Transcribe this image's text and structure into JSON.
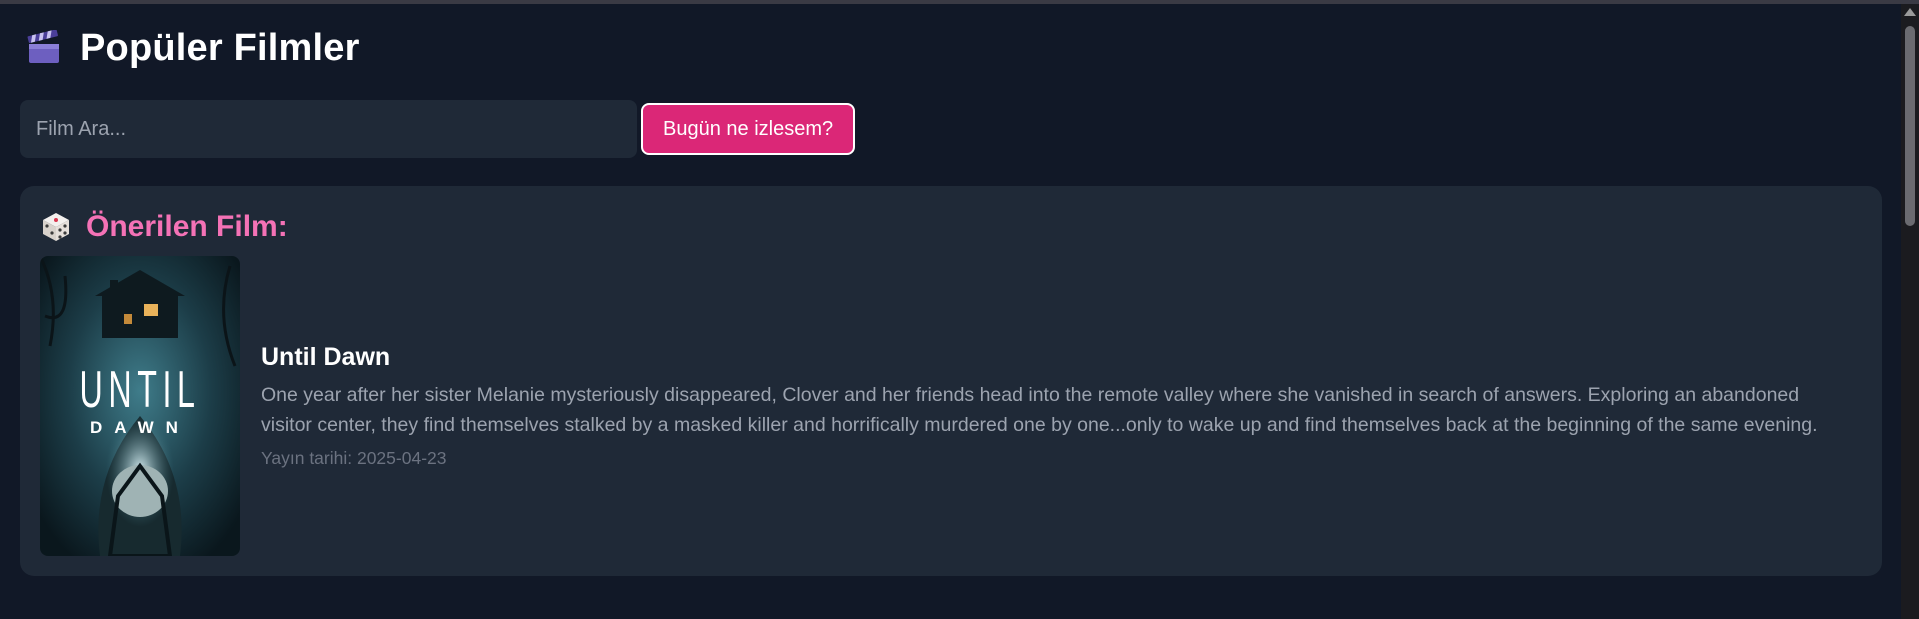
{
  "header": {
    "title": "Popüler Filmler",
    "icon": "clapperboard-icon"
  },
  "search": {
    "placeholder": "Film Ara...",
    "value": ""
  },
  "random_button": {
    "label": "Bugün ne izlesem?",
    "color": "#db2777"
  },
  "recommended": {
    "heading": "Önerilen Film:",
    "icon": "dice-icon",
    "heading_color": "#f472b6",
    "movie": {
      "title": "Until Dawn",
      "overview": "One year after her sister Melanie mysteriously disappeared, Clover and her friends head into the remote valley where she vanished in search of answers. Exploring an abandoned visitor center, they find themselves stalked by a masked killer and horrifically murdered one by one...only to wake up and find themselves back at the beginning of the same evening.",
      "release": "Yayın tarihi: 2025-04-23",
      "poster": {
        "word1": "UNTIL",
        "word2": "DAWN"
      }
    }
  },
  "colors": {
    "background": "#111827",
    "card": "#1f2937",
    "text_muted": "#9ca3af"
  }
}
